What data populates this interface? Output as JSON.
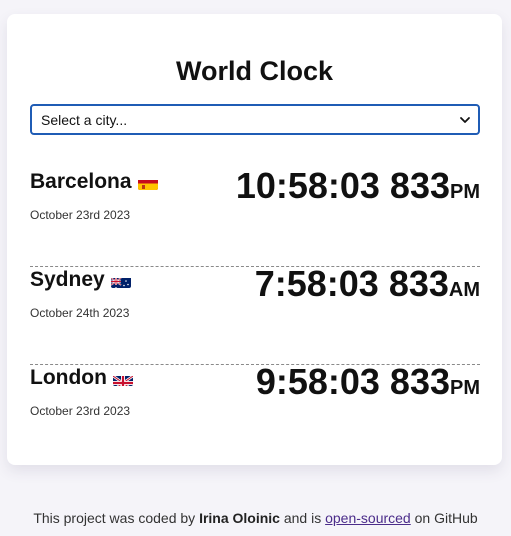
{
  "app": {
    "title": "World Clock"
  },
  "city_select": {
    "placeholder": "Select a city..."
  },
  "cities": [
    {
      "name": "Barcelona",
      "flag": "spain-flag",
      "date": "October 23rd 2023",
      "time": "10:58:03 833",
      "period": "PM"
    },
    {
      "name": "Sydney",
      "flag": "australia-flag",
      "date": "October 24th 2023",
      "time": "7:58:03 833",
      "period": "AM"
    },
    {
      "name": "London",
      "flag": "uk-flag",
      "date": "October 23rd 2023",
      "time": "9:58:03 833",
      "period": "PM"
    }
  ],
  "footer": {
    "prefix": "This project was coded by",
    "author": "Irina Oloinic",
    "middle": "and is",
    "link_text": "open-sourced",
    "suffix": "on GitHub"
  },
  "colors": {
    "background": "#f5f4f9",
    "card": "#ffffff",
    "select_border": "#1f5cb5",
    "link": "#4b2c8a"
  }
}
